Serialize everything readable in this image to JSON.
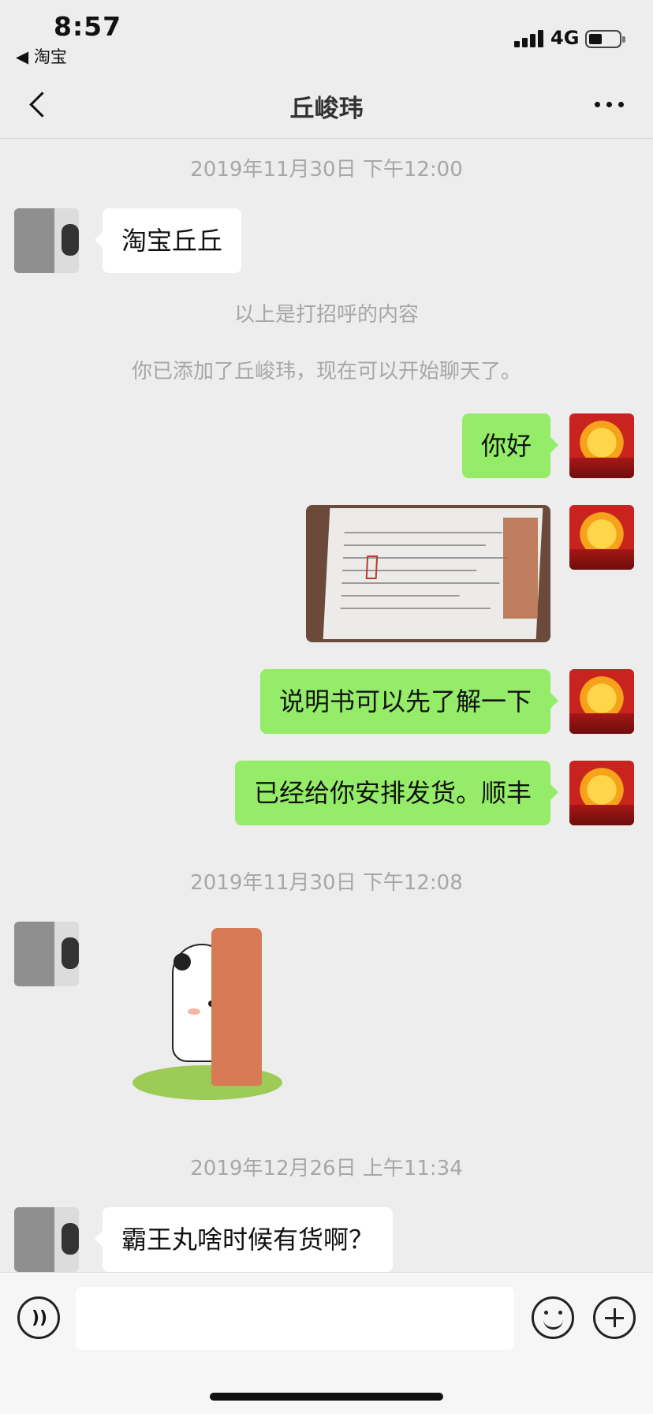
{
  "status_bar": {
    "time": "8:57",
    "back_app": "◀ 淘宝",
    "network": "4G"
  },
  "nav": {
    "title": "丘峻玮"
  },
  "chat": {
    "timestamps": [
      "2019年11月30日 下午12:00",
      "2019年11月30日 下午12:08",
      "2019年12月26日 上午11:34"
    ],
    "system_messages": [
      "以上是打招呼的内容",
      "你已添加了丘峻玮，现在可以开始聊天了。"
    ],
    "messages": [
      {
        "from": "peer",
        "type": "text",
        "text": "淘宝丘丘"
      },
      {
        "from": "self",
        "type": "text",
        "text": "你好"
      },
      {
        "from": "self",
        "type": "image",
        "text": ""
      },
      {
        "from": "self",
        "type": "text",
        "text": "说明书可以先了解一下"
      },
      {
        "from": "self",
        "type": "text",
        "text": "已经给你安排发货。顺丰"
      },
      {
        "from": "peer",
        "type": "sticker",
        "text": ""
      },
      {
        "from": "peer",
        "type": "text",
        "text": "霸王丸啥时候有货啊？"
      }
    ]
  },
  "input_bar": {
    "input_value": "",
    "icons": [
      "voice-icon",
      "emoji-icon",
      "plus-icon"
    ]
  },
  "colors": {
    "background": "#ededed",
    "outgoing_bubble": "#95ec69",
    "incoming_bubble": "#ffffff",
    "timestamp_text": "#a7a7a7"
  }
}
